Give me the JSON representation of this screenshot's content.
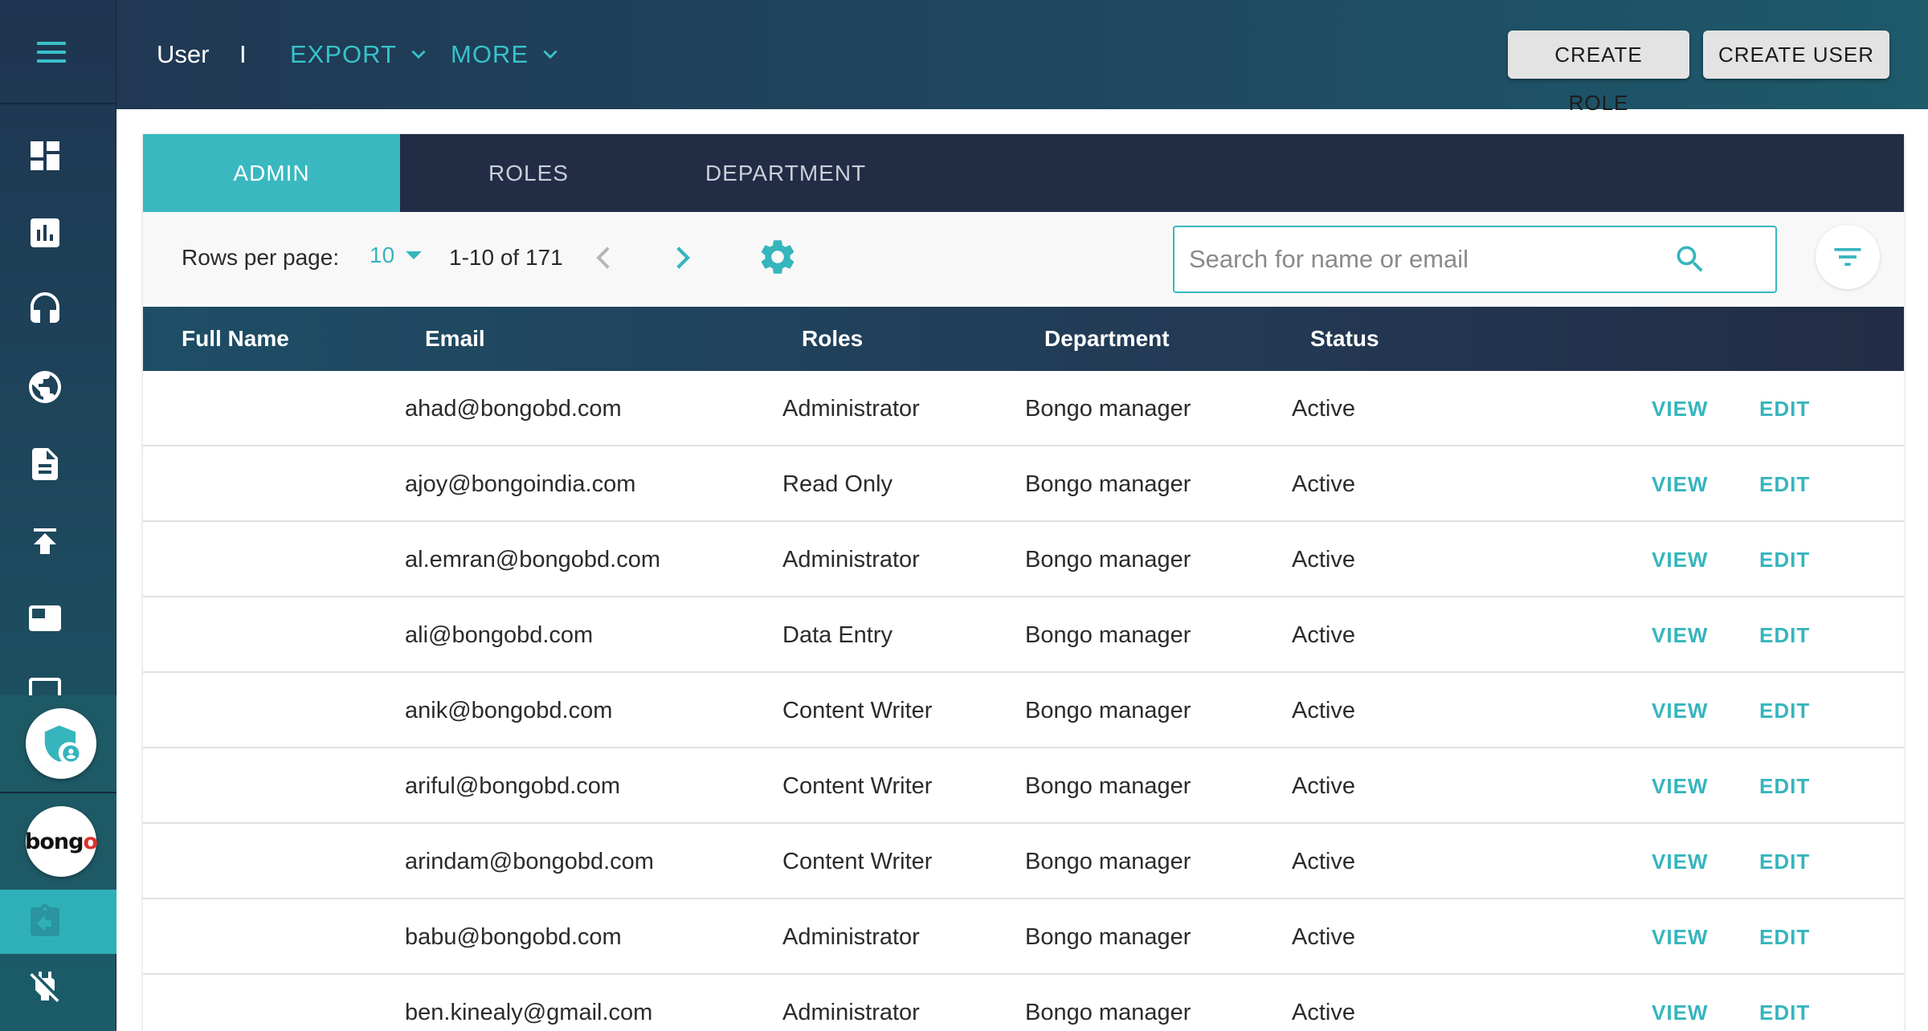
{
  "header": {
    "title": "User",
    "separator": "I",
    "export_label": "EXPORT",
    "more_label": "MORE",
    "create_role_label": "CREATE ROLE",
    "create_user_label": "CREATE USER"
  },
  "sidebar": {
    "items": [
      {
        "icon": "menu-icon"
      },
      {
        "icon": "dashboard-icon"
      },
      {
        "icon": "bar-chart-icon"
      },
      {
        "icon": "headset-icon"
      },
      {
        "icon": "globe-icon"
      },
      {
        "icon": "document-icon"
      },
      {
        "icon": "upload-icon"
      },
      {
        "icon": "media-icon"
      },
      {
        "icon": "monitor-icon"
      },
      {
        "icon": "admin-shield-icon"
      },
      {
        "icon": "bongo-logo-icon"
      },
      {
        "icon": "clipboard-back-icon",
        "active": true
      },
      {
        "icon": "plug-off-icon"
      }
    ],
    "logo_text": "bongo"
  },
  "tabs": [
    {
      "label": "ADMIN",
      "active": true
    },
    {
      "label": "ROLES",
      "active": false
    },
    {
      "label": "DEPARTMENT",
      "active": false
    }
  ],
  "toolbar": {
    "rows_per_page_label": "Rows per page:",
    "rows_per_page_value": "10",
    "range_text": "1-10 of 171",
    "search_placeholder": "Search for name or email"
  },
  "table": {
    "columns": [
      "Full Name",
      "Email",
      "Roles",
      "Department",
      "Status"
    ],
    "view_label": "VIEW",
    "edit_label": "EDIT",
    "rows": [
      {
        "full_name": "",
        "email": "ahad@bongobd.com",
        "role": "Administrator",
        "department": "Bongo manager",
        "status": "Active"
      },
      {
        "full_name": "",
        "email": "ajoy@bongoindia.com",
        "role": "Read Only",
        "department": "Bongo manager",
        "status": "Active"
      },
      {
        "full_name": "",
        "email": "al.emran@bongobd.com",
        "role": "Administrator",
        "department": "Bongo manager",
        "status": "Active"
      },
      {
        "full_name": "",
        "email": "ali@bongobd.com",
        "role": "Data Entry",
        "department": "Bongo manager",
        "status": "Active"
      },
      {
        "full_name": "",
        "email": "anik@bongobd.com",
        "role": "Content Writer",
        "department": "Bongo manager",
        "status": "Active"
      },
      {
        "full_name": "",
        "email": "ariful@bongobd.com",
        "role": "Content Writer",
        "department": "Bongo manager",
        "status": "Active"
      },
      {
        "full_name": "",
        "email": "arindam@bongobd.com",
        "role": "Content Writer",
        "department": "Bongo manager",
        "status": "Active"
      },
      {
        "full_name": "",
        "email": "babu@bongobd.com",
        "role": "Administrator",
        "department": "Bongo manager",
        "status": "Active"
      },
      {
        "full_name": "",
        "email": "ben.kinealy@gmail.com",
        "role": "Administrator",
        "department": "Bongo manager",
        "status": "Active"
      }
    ]
  },
  "colors": {
    "accent": "#36b5bd",
    "header_dark": "#222c45",
    "sidebar": "#1f3450"
  }
}
